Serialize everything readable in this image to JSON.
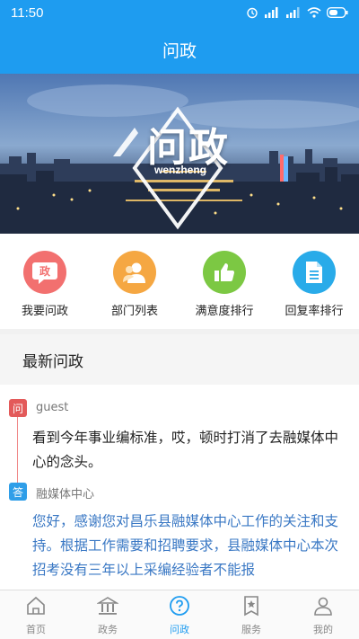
{
  "status_bar": {
    "time": "11:50"
  },
  "header": {
    "title": "问政"
  },
  "banner": {
    "logo_text": "问政",
    "logo_subtext": "wenzheng"
  },
  "quick_menu": [
    {
      "label": "我要问政",
      "icon": "petition-icon",
      "color": "#f2706f",
      "glyph": "政"
    },
    {
      "label": "部门列表",
      "icon": "department-icon",
      "color": "#f5a742"
    },
    {
      "label": "满意度排行",
      "icon": "thumbs-up-icon",
      "color": "#7cc843"
    },
    {
      "label": "回复率排行",
      "icon": "document-icon",
      "color": "#29abe9"
    }
  ],
  "section": {
    "title": "最新问政"
  },
  "question": {
    "badge": "问",
    "author": "guest",
    "text": "看到今年事业编标准，哎，顿时打消了去融媒体中心的念头。"
  },
  "answer": {
    "badge": "答",
    "author": "融媒体中心",
    "text": "您好，感谢您对昌乐县融媒体中心工作的关注和支持。根据工作需要和招聘要求，县融媒体中心本次招考没有三年以上采编经验者不能报"
  },
  "bottom_nav": [
    {
      "label": "首页",
      "icon": "home-icon"
    },
    {
      "label": "政务",
      "icon": "government-icon"
    },
    {
      "label": "问政",
      "icon": "question-icon",
      "active": true
    },
    {
      "label": "服务",
      "icon": "service-icon"
    },
    {
      "label": "我的",
      "icon": "user-icon"
    }
  ],
  "colors": {
    "primary": "#1e9cf0",
    "answer_text": "#3a78c4",
    "question_badge": "#e35a5a"
  }
}
